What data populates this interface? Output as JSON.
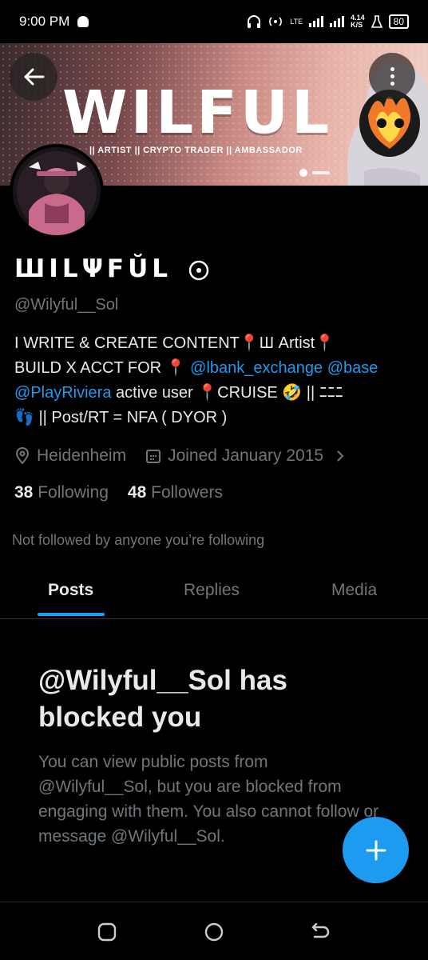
{
  "status": {
    "time": "9:00 PM",
    "network_label": "LTE",
    "speed_value": "4.14",
    "speed_unit": "K/S",
    "battery": "80"
  },
  "banner": {
    "title": "WILFUL",
    "subtitle": "|| ARTIST || CRYPTO TRADER || AMBASSADOR"
  },
  "profile": {
    "display_name": "ШILΨFŬL",
    "handle": "@Wilyful__Sol",
    "bio": {
      "line1": "I WRITE & CREATE CONTENT📍Ш Artist📍",
      "line2_text": "BUILD X ACCT FOR 📍 ",
      "mention_lbank": "@lbank_exchange",
      "mention_base": "@base",
      "mention_riviera": "@PlayRiviera",
      "line3_text": " active user 📍CRUISE 🤣 || ﾆﾆﾆ",
      "line4": "👣 || Post/RT = NFA ( DYOR )"
    },
    "location": "Heidenheim",
    "joined": "Joined January 2015",
    "following_count": "38",
    "following_label": "Following",
    "followers_count": "48",
    "followers_label": "Followers",
    "not_followed": "Not followed by anyone you’re following"
  },
  "tabs": [
    {
      "label": "Posts",
      "active": true
    },
    {
      "label": "Replies",
      "active": false
    },
    {
      "label": "Media",
      "active": false
    }
  ],
  "blocked": {
    "title": "@Wilyful__Sol has blocked you",
    "body": "You can view public posts from @Wilyful__Sol, but you are blocked from engaging with them. You also cannot follow or message @Wilyful__Sol."
  },
  "colors": {
    "accent": "#1d9bf0",
    "background": "#000000",
    "muted": "#71767b"
  }
}
